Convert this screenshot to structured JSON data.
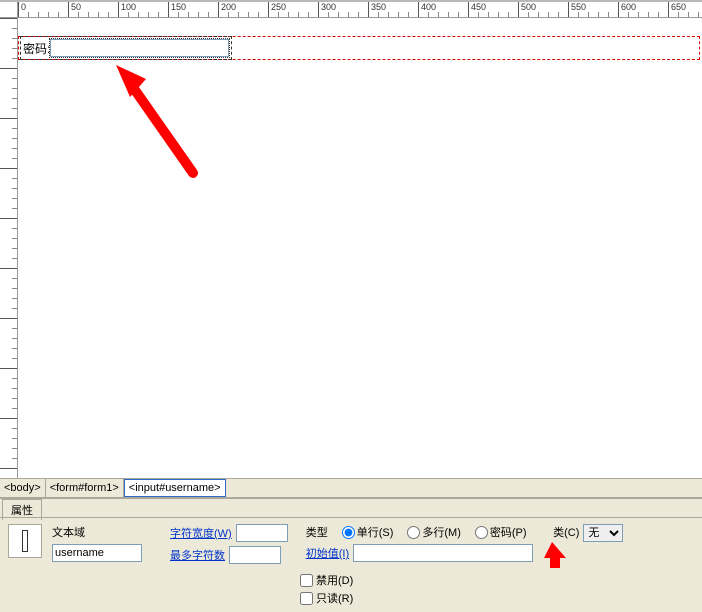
{
  "ruler_major_marks": [
    0,
    50,
    100,
    150,
    200,
    250,
    300,
    350,
    400,
    450,
    500,
    550,
    600,
    650
  ],
  "canvas": {
    "field_label": "密码:"
  },
  "tags": {
    "body": "<body>",
    "form": "<form#form1>",
    "input": "<input#username>"
  },
  "props_tab": "属性",
  "props": {
    "group_label": "文本域",
    "name_value": "username",
    "char_width_label": "字符宽度(W)",
    "max_chars_label": "最多字符数",
    "init_val_label": "初始值(I)",
    "type_label": "类型",
    "radio_single": "单行(S)",
    "radio_multi": "多行(M)",
    "radio_password": "密码(P)",
    "class_label": "类(C)",
    "class_value": "无",
    "disabled_label": "禁用(D)",
    "readonly_label": "只读(R)"
  }
}
